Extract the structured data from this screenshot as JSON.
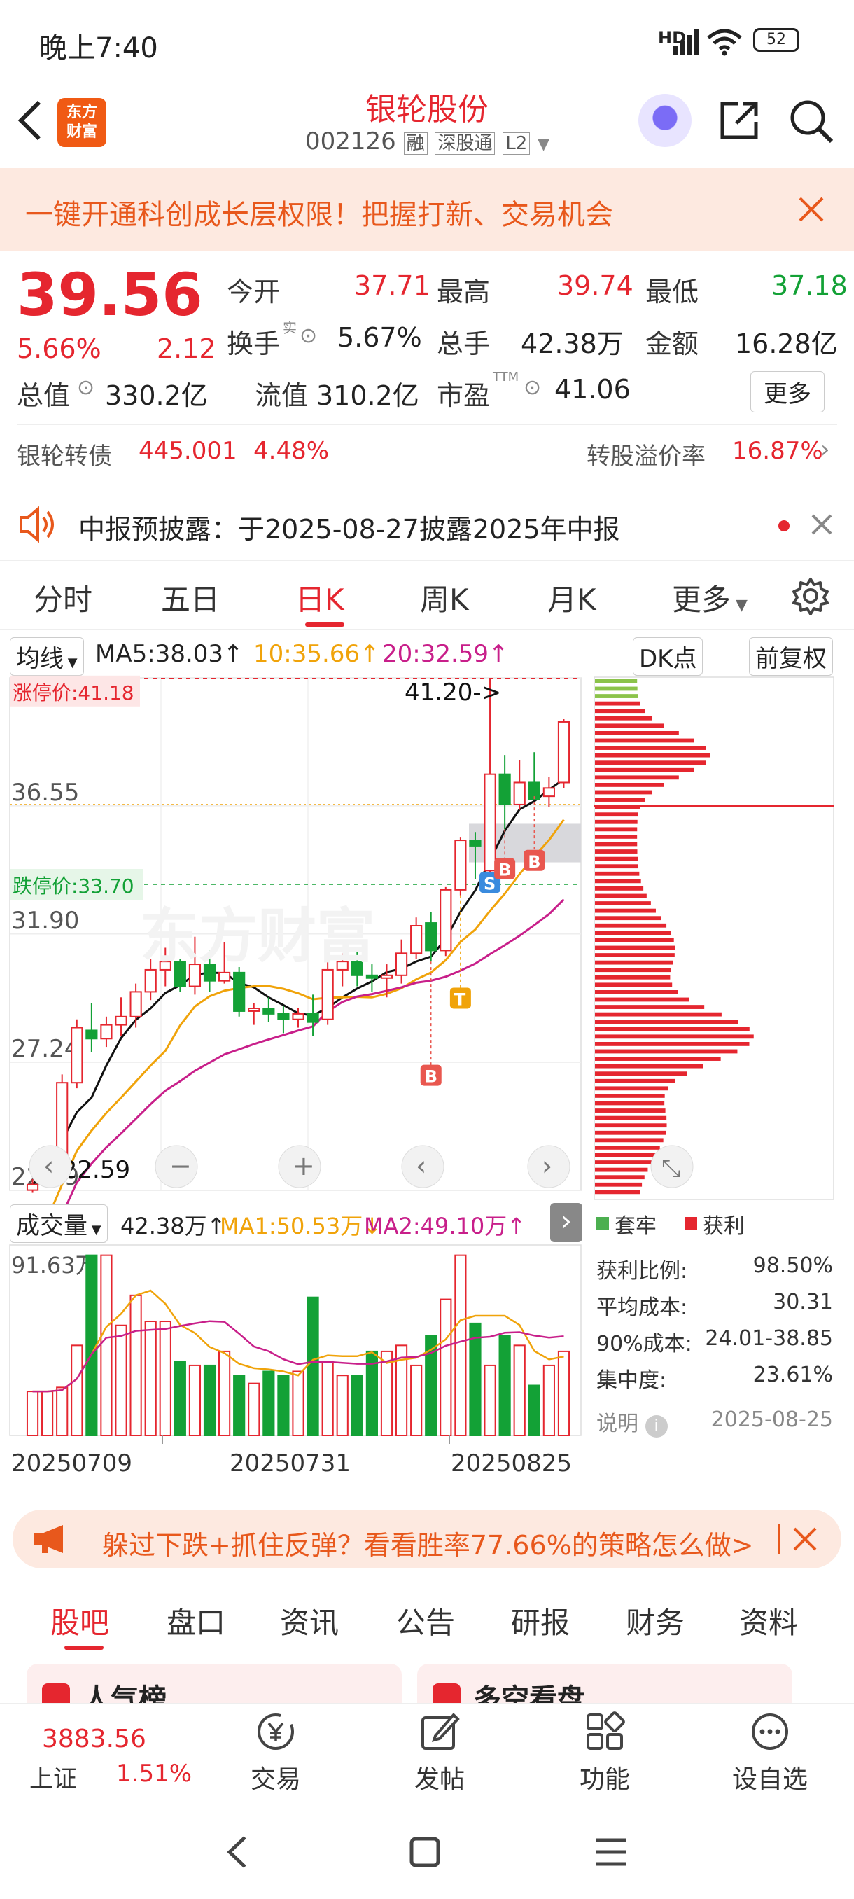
{
  "status": {
    "time": "晚上7:40",
    "battery": "52",
    "net": "HD"
  },
  "header": {
    "logo_line1": "东方",
    "logo_line2": "财富",
    "title": "银轮股份",
    "code": "002126",
    "tags": [
      "融",
      "深股通",
      "L2"
    ]
  },
  "banner": {
    "text": "一键开通科创成长层权限！把握打新、交易机会"
  },
  "quote": {
    "price": "39.56",
    "pct": "5.66%",
    "chg": "2.12",
    "open_l": "今开",
    "open": "37.71",
    "high_l": "最高",
    "high": "39.74",
    "low_l": "最低",
    "low": "37.18",
    "turn_l": "换手",
    "turn_sup": "实",
    "turn": "5.67%",
    "vol_l": "总手",
    "vol": "42.38万",
    "amt_l": "金额",
    "amt": "16.28亿",
    "mcap_l": "总值",
    "mcap": "330.2亿",
    "float_l": "流值",
    "float": "310.2亿",
    "pe_l": "市盈",
    "pe_sup": "TTM",
    "pe": "41.06",
    "more": "更多",
    "bond_l": "银轮转债",
    "bond": "445.001",
    "bond_pct": "4.48%",
    "prem_l": "转股溢价率",
    "prem": "16.87%"
  },
  "notice": {
    "text": "中报预披露：于2025-08-27披露2025年中报"
  },
  "tabs": [
    "分时",
    "五日",
    "日K",
    "周K",
    "月K",
    "更多"
  ],
  "active_tab": "日K",
  "kline": {
    "ind": "均线",
    "ma5": "MA5:38.03↑",
    "ma10": "10:35.66↑",
    "ma20": "20:32.59↑",
    "dk": "DK点",
    "fq": "前复权",
    "limit_up": "涨停价:41.18",
    "limit_down": "跌停价:33.70",
    "high_mark": "41.20->",
    "low_mark": "<-22.59",
    "ticks": [
      "41.20",
      "36.55",
      "31.90",
      "27.24",
      "22.59"
    ],
    "watermark": "东方财富",
    "signals": [
      "B",
      "T",
      "S",
      "B",
      "B"
    ]
  },
  "volume": {
    "label": "成交量",
    "vol": "42.38万↑",
    "ma1": "MA1:50.53万↓",
    "ma2": "MA2:49.10万↑",
    "max": "91.63万",
    "dates": [
      "20250709",
      "20250731",
      "20250825"
    ]
  },
  "chip": {
    "legend_a": "套牢",
    "legend_b": "获利",
    "rows": [
      {
        "k": "获利比例:",
        "v": "98.50%"
      },
      {
        "k": "平均成本:",
        "v": "30.31"
      },
      {
        "k": "90%成本:",
        "v": "24.01-38.85"
      },
      {
        "k": "集中度:",
        "v": "23.61%"
      }
    ],
    "note": "说明",
    "date": "2025-08-25"
  },
  "ad": {
    "text": "躲过下跌+抓住反弹？看看胜率77.66%的策略怎么做>"
  },
  "bottom_tabs": [
    "股吧",
    "盘口",
    "资讯",
    "公告",
    "研报",
    "财务",
    "资料"
  ],
  "cards": [
    "人气榜",
    "多空看盘"
  ],
  "index": {
    "value": "3883.56",
    "name": "上证",
    "pct": "1.51%"
  },
  "nav": [
    "交易",
    "发帖",
    "功能",
    "设自选"
  ],
  "chart_data": {
    "type": "candlestick",
    "candles": [
      [
        22.6,
        23.0,
        22.5,
        22.8
      ],
      [
        22.8,
        24.0,
        22.7,
        23.9
      ],
      [
        23.9,
        26.8,
        23.7,
        26.5
      ],
      [
        26.5,
        28.8,
        26.3,
        28.5
      ],
      [
        28.4,
        29.4,
        27.6,
        28.1
      ],
      [
        28.1,
        28.9,
        27.8,
        28.6
      ],
      [
        28.6,
        29.6,
        28.2,
        28.9
      ],
      [
        28.9,
        30.1,
        28.5,
        29.8
      ],
      [
        29.8,
        31.0,
        29.5,
        30.6
      ],
      [
        30.6,
        31.4,
        30.0,
        30.9
      ],
      [
        30.9,
        31.0,
        29.8,
        30.0
      ],
      [
        30.0,
        31.8,
        29.7,
        30.8
      ],
      [
        30.8,
        31.3,
        29.8,
        30.2
      ],
      [
        30.2,
        31.6,
        30.1,
        30.5
      ],
      [
        30.5,
        30.7,
        28.9,
        29.1
      ],
      [
        29.1,
        29.4,
        28.6,
        29.2
      ],
      [
        29.2,
        29.6,
        28.7,
        29.0
      ],
      [
        29.0,
        29.3,
        28.3,
        28.8
      ],
      [
        28.8,
        29.2,
        28.5,
        29.0
      ],
      [
        29.0,
        29.7,
        28.2,
        28.7
      ],
      [
        28.8,
        31.0,
        28.6,
        30.6
      ],
      [
        30.6,
        31.2,
        30.0,
        30.9
      ],
      [
        30.9,
        31.3,
        30.0,
        30.4
      ],
      [
        30.4,
        30.8,
        29.8,
        30.3
      ],
      [
        30.3,
        30.8,
        29.6,
        30.4
      ],
      [
        30.4,
        31.7,
        30.1,
        31.2
      ],
      [
        31.2,
        32.5,
        31.0,
        32.2
      ],
      [
        32.3,
        32.7,
        30.9,
        31.3
      ],
      [
        31.3,
        33.6,
        31.1,
        33.5
      ],
      [
        33.5,
        35.4,
        33.3,
        35.3
      ],
      [
        35.3,
        35.6,
        33.9,
        35.1
      ],
      [
        34.2,
        41.2,
        34.0,
        37.7
      ],
      [
        37.7,
        38.4,
        35.7,
        36.6
      ],
      [
        36.6,
        38.2,
        36.4,
        37.4
      ],
      [
        37.4,
        38.5,
        36.9,
        36.8
      ],
      [
        36.9,
        37.6,
        36.5,
        37.2
      ],
      [
        37.4,
        39.7,
        37.2,
        39.6
      ]
    ],
    "volume": [
      22,
      22,
      24,
      45,
      90,
      90,
      55,
      70,
      57,
      57,
      37,
      35,
      35,
      42,
      30,
      26,
      32,
      30,
      32,
      69,
      37,
      30,
      30,
      42,
      42,
      45,
      35,
      50,
      68,
      90,
      56,
      35,
      50,
      45,
      25,
      35,
      42
    ]
  }
}
